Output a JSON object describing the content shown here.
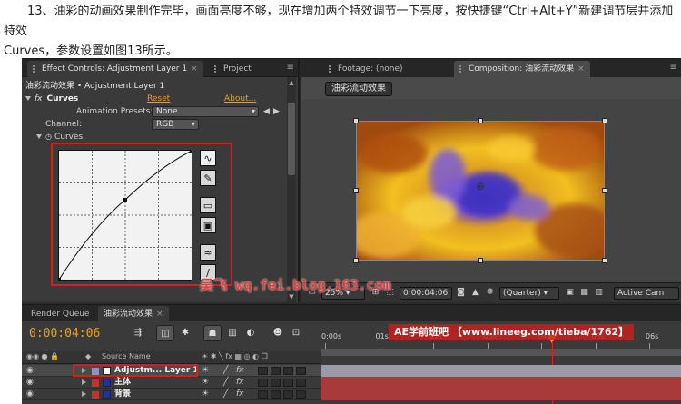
{
  "article": {
    "intro_line1": "13、油彩的动画效果制作完毕，画面亮度不够，现在增加两个特效调节一下亮度，按快捷键“Ctrl+Alt+Y”新建调节层并添加特效",
    "intro_line2": "Curves，参数设置如图13所示。"
  },
  "effect_controls": {
    "tab_label": "Effect Controls: Adjustment Layer 1",
    "tab_close": "×",
    "project_tab": "Project",
    "breadcrumb": "油彩流动效果 • Adjustment Layer 1",
    "effect_fx": "fx",
    "effect_name": "Curves",
    "reset": "Reset",
    "about": "About...",
    "animation_presets_label": "Animation Presets:",
    "animation_presets_value": "None",
    "channel_label": "Channel:",
    "channel_value": "RGB",
    "curves_group": "Curves"
  },
  "curves": {
    "points": [
      [
        0,
        0
      ],
      [
        0.5,
        0.62
      ],
      [
        1,
        1
      ]
    ],
    "tools": [
      "curve-tool-icon",
      "pencil-icon",
      "open-icon",
      "save-icon",
      "smooth-icon",
      "linear-icon"
    ]
  },
  "composition": {
    "footage_tab": "Footage: (none)",
    "comp_tab": "Composition: 油彩流动效果",
    "comp_name_button": "油彩流动效果",
    "zoom": "25%",
    "time": "0:00:04:06",
    "resolution": "(Quarter)",
    "camera": "Active Cam"
  },
  "watermark": {
    "text_kanji": "昊飞",
    "text": " wq.fei.blog.163.com",
    "ae_text": "AE学前班吧 【www.lineeg.com/tieba/1762】"
  },
  "timeline": {
    "render_queue_tab": "Render Queue",
    "comp_tab": "油彩流动效果",
    "timecode": "0:00:04:06",
    "source_name_header": "Source Name",
    "ticks": [
      "0:00s",
      "01s",
      "02s",
      "03s",
      "04s",
      "05s",
      "06s"
    ],
    "playhead_seconds": 4.2,
    "layers": [
      {
        "name": "Adjustm... Layer 1",
        "label_color": "#9090c8",
        "square_color": "#ffffff",
        "bar_color": "#9a9aa8"
      },
      {
        "name": "主体",
        "label_color": "#c8302e",
        "square_color": "#2030a0",
        "bar_color": "#a83a3a"
      },
      {
        "name": "背景",
        "label_color": "#c8302e",
        "square_color": "#2030a0",
        "bar_color": "#a83a3a"
      }
    ]
  },
  "colors": {
    "highlight": "#d21f1f",
    "accent": "#e8a21f"
  }
}
